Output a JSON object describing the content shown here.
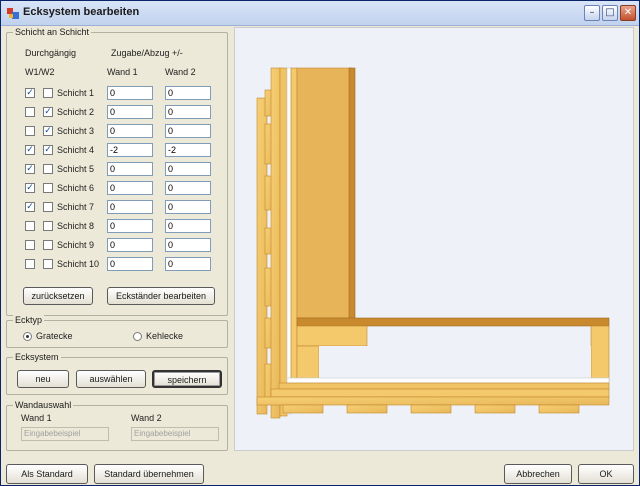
{
  "window": {
    "title": "Ecksystem bearbeiten"
  },
  "schicht": {
    "legend": "Schicht an Schicht",
    "col_durchgaengig": "Durchgängig",
    "col_zugabe": "Zugabe/Abzug +/-",
    "col_w1w2": "W1/W2",
    "col_wand1": "Wand 1",
    "col_wand2": "Wand 2",
    "rows": [
      {
        "label": "Schicht 1",
        "w1": true,
        "w2": false,
        "wand1": "0",
        "wand2": "0"
      },
      {
        "label": "Schicht 2",
        "w1": false,
        "w2": true,
        "wand1": "0",
        "wand2": "0"
      },
      {
        "label": "Schicht 3",
        "w1": false,
        "w2": true,
        "wand1": "0",
        "wand2": "0"
      },
      {
        "label": "Schicht 4",
        "w1": true,
        "w2": true,
        "wand1": "-2",
        "wand2": "-2"
      },
      {
        "label": "Schicht 5",
        "w1": true,
        "w2": false,
        "wand1": "0",
        "wand2": "0"
      },
      {
        "label": "Schicht 6",
        "w1": true,
        "w2": false,
        "wand1": "0",
        "wand2": "0"
      },
      {
        "label": "Schicht 7",
        "w1": true,
        "w2": false,
        "wand1": "0",
        "wand2": "0"
      },
      {
        "label": "Schicht 8",
        "w1": false,
        "w2": false,
        "wand1": "0",
        "wand2": "0"
      },
      {
        "label": "Schicht 9",
        "w1": false,
        "w2": false,
        "wand1": "0",
        "wand2": "0"
      },
      {
        "label": "Schicht 10",
        "w1": false,
        "w2": false,
        "wand1": "0",
        "wand2": "0"
      }
    ],
    "reset_label": "zurücksetzen",
    "eckstaender_label": "Eckständer bearbeiten"
  },
  "ecktyp": {
    "legend": "Ecktyp",
    "option1": "Gratecke",
    "option2": "Kehlecke",
    "selected": "Gratecke"
  },
  "ecksystem": {
    "legend": "Ecksystem",
    "neu_label": "neu",
    "auswaehlen_label": "auswählen",
    "speichern_label": "speichern"
  },
  "wandauswahl": {
    "legend": "Wandauswahl",
    "wand1_label": "Wand 1",
    "wand2_label": "Wand 2",
    "wand1_placeholder": "Eingabebeispiel",
    "wand2_placeholder": "Eingabebeispiel"
  },
  "footer": {
    "als_standard": "Als Standard",
    "standard_uebernehmen": "Standard übernehmen",
    "abbrechen": "Abbrechen",
    "ok": "OK"
  },
  "colors": {
    "wood_light": "#f3c96c",
    "wood_dark": "#c98a2e",
    "wood_edge": "#b8772a",
    "insulation": "#ffffff",
    "canvas_bg": "#eef2f8"
  }
}
